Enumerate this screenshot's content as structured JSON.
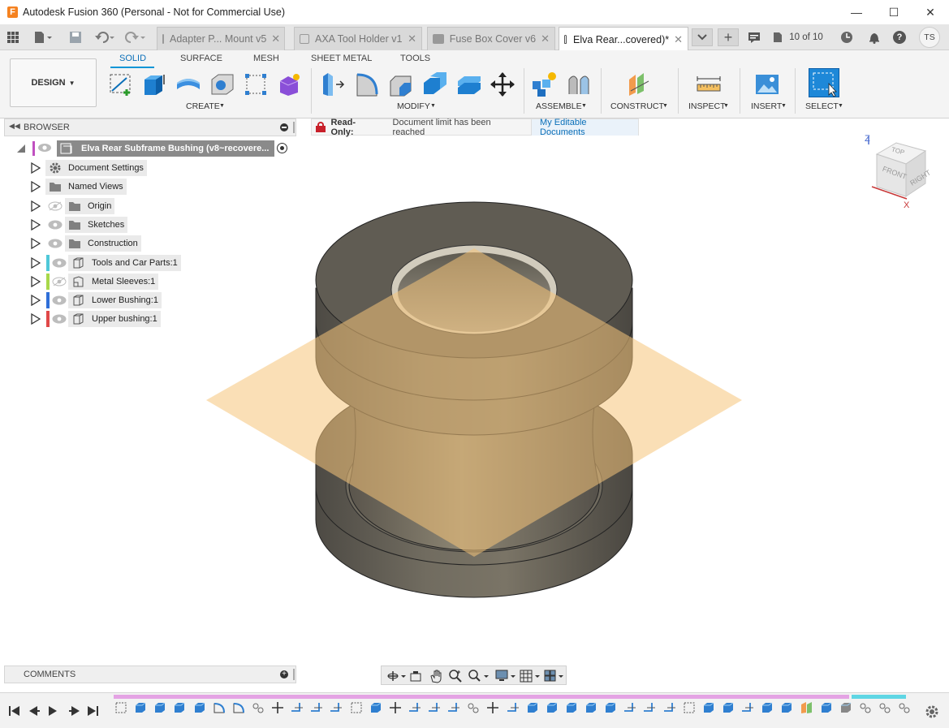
{
  "window": {
    "title": "Autodesk Fusion 360 (Personal - Not for Commercial Use)",
    "minimize": "—",
    "maximize": "☐",
    "close": "✕"
  },
  "tabs": [
    {
      "label": "Adapter P... Mount v5",
      "active": false
    },
    {
      "label": "AXA Tool Holder v1",
      "active": false
    },
    {
      "label": "Fuse Box Cover v6",
      "active": false
    },
    {
      "label": "Elva Rear...covered)*",
      "active": true
    }
  ],
  "tabbar": {
    "counter": "10 of 10",
    "user_initials": "TS"
  },
  "ribbon": {
    "workspace": "DESIGN",
    "tabs": [
      "SOLID",
      "SURFACE",
      "MESH",
      "SHEET METAL",
      "TOOLS"
    ],
    "groups": [
      "CREATE",
      "MODIFY",
      "ASSEMBLE",
      "CONSTRUCT",
      "INSPECT",
      "INSERT",
      "SELECT"
    ]
  },
  "browser": {
    "title": "BROWSER",
    "root": "Elva Rear Subframe Bushing (v8~recovere...",
    "items": [
      {
        "label": "Document Settings",
        "icon": "gear-icon",
        "color": ""
      },
      {
        "label": "Named Views",
        "icon": "folder-icon",
        "color": ""
      },
      {
        "label": "Origin",
        "icon": "folder-icon",
        "color": ""
      },
      {
        "label": "Sketches",
        "icon": "folder-icon",
        "color": ""
      },
      {
        "label": "Construction",
        "icon": "folder-icon",
        "color": ""
      },
      {
        "label": "Tools and Car Parts:1",
        "icon": "component-icon",
        "color": "#4fc8d8"
      },
      {
        "label": "Metal Sleeves:1",
        "icon": "component-link-icon",
        "color": "#a8d84a"
      },
      {
        "label": "Lower Bushing:1",
        "icon": "component-icon",
        "color": "#2f6fd8"
      },
      {
        "label": "Upper bushing:1",
        "icon": "component-icon",
        "color": "#e04848"
      }
    ]
  },
  "readonly": {
    "label": "Read-Only:",
    "message": "Document limit has been reached",
    "link": "My Editable Documents"
  },
  "viewcube": {
    "top": "TOP",
    "front": "FRONT",
    "right": "RIGHT",
    "z": "Z",
    "x": "X"
  },
  "comments": {
    "title": "COMMENTS"
  },
  "colors": {
    "accent": "#0696d7",
    "plane": "#f5c47a",
    "body": "#6b6658"
  }
}
